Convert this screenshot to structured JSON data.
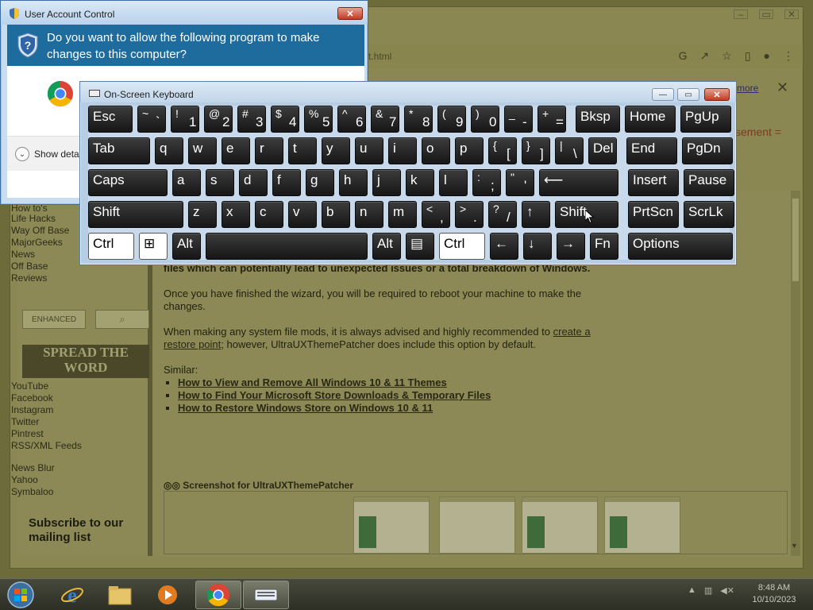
{
  "browser": {
    "address_partial": "t.html",
    "read_more": "more",
    "partial_right": "sement ="
  },
  "sidebar": {
    "links_top": [
      "How to's",
      "Life Hacks",
      "Way Off Base",
      "MajorGeeks",
      "News",
      "Off Base",
      "Reviews"
    ],
    "enhanced_label": "ENHANCED",
    "spread_line1": "SPREAD THE",
    "spread_line2": "WORD",
    "social_links": [
      "YouTube",
      "Facebook",
      "Instagram",
      "Twitter",
      "Pintrest",
      "RSS/XML Feeds"
    ],
    "reader_links": [
      "News Blur",
      "Yahoo",
      "Symbaloo"
    ],
    "subscribe": "Subscribe to our mailing list"
  },
  "article": {
    "p1": "files which can potentially lead to unexpected issues or a total breakdown of Windows.",
    "p2": "Once you have finished the wizard, you will be required to reboot your machine to make the changes.",
    "p3_before": "When making any system file mods, it is always advised and highly recommended to ",
    "p3_link": "create a restore point",
    "p3_after": "; however, UltraUXThemePatcher does include this option by default.",
    "similar_label": "Similar:",
    "similar": [
      "How to View and Remove All Windows 10 & 11 Themes",
      "How to Find Your Microsoft Store Downloads & Temporary Files",
      "How to Restore Windows Store on Windows 10 & 11"
    ],
    "screenshot_caption": "Screenshot for UltraUXThemePatcher"
  },
  "uac": {
    "title": "User Account Control",
    "close": "✕",
    "question": "Do you want to allow the following program to make changes to this computer?",
    "details": "Show detai"
  },
  "osk": {
    "title": "On-Screen Keyboard",
    "minimize": "—",
    "maximize": "▭",
    "close": "✕",
    "rows": [
      [
        {
          "label": "Esc"
        },
        {
          "top": "~",
          "bot": "`"
        },
        {
          "top": "!",
          "bot": "1"
        },
        {
          "top": "@",
          "bot": "2"
        },
        {
          "top": "#",
          "bot": "3"
        },
        {
          "top": "$",
          "bot": "4"
        },
        {
          "top": "%",
          "bot": "5"
        },
        {
          "top": "^",
          "bot": "6"
        },
        {
          "top": "&",
          "bot": "7"
        },
        {
          "top": "*",
          "bot": "8"
        },
        {
          "top": "(",
          "bot": "9"
        },
        {
          "top": ")",
          "bot": "0"
        },
        {
          "top": "_",
          "bot": "-"
        },
        {
          "top": "+",
          "bot": "="
        },
        {
          "label": "Bksp"
        },
        {
          "label": "Home"
        },
        {
          "label": "PgUp"
        }
      ],
      [
        {
          "label": "Tab"
        },
        {
          "label": "q"
        },
        {
          "label": "w"
        },
        {
          "label": "e"
        },
        {
          "label": "r"
        },
        {
          "label": "t"
        },
        {
          "label": "y"
        },
        {
          "label": "u"
        },
        {
          "label": "i"
        },
        {
          "label": "o"
        },
        {
          "label": "p"
        },
        {
          "top": "{",
          "bot": "["
        },
        {
          "top": "}",
          "bot": "]"
        },
        {
          "top": "|",
          "bot": "\\"
        },
        {
          "label": "Del"
        },
        {
          "label": "End"
        },
        {
          "label": "PgDn"
        }
      ],
      [
        {
          "label": "Caps"
        },
        {
          "label": "a"
        },
        {
          "label": "s"
        },
        {
          "label": "d"
        },
        {
          "label": "f"
        },
        {
          "label": "g"
        },
        {
          "label": "h"
        },
        {
          "label": "j"
        },
        {
          "label": "k"
        },
        {
          "label": "l"
        },
        {
          "top": ":",
          "bot": ";"
        },
        {
          "top": "\"",
          "bot": "'"
        },
        {
          "label": "⟵"
        },
        {
          "label": "Insert"
        },
        {
          "label": "Pause"
        }
      ],
      [
        {
          "label": "Shift"
        },
        {
          "label": "z"
        },
        {
          "label": "x"
        },
        {
          "label": "c"
        },
        {
          "label": "v"
        },
        {
          "label": "b"
        },
        {
          "label": "n"
        },
        {
          "label": "m"
        },
        {
          "top": "<",
          "bot": ","
        },
        {
          "top": ">",
          "bot": "."
        },
        {
          "top": "?",
          "bot": "/"
        },
        {
          "label": "↑"
        },
        {
          "label": "Shift"
        },
        {
          "label": "PrtScn"
        },
        {
          "label": "ScrLk"
        }
      ],
      [
        {
          "label": "Ctrl"
        },
        {
          "label": "⊞"
        },
        {
          "label": "Alt"
        },
        {
          "label": ""
        },
        {
          "label": "Alt"
        },
        {
          "label": "▤"
        },
        {
          "label": "Ctrl"
        },
        {
          "label": "←"
        },
        {
          "label": "↓"
        },
        {
          "label": "→"
        },
        {
          "label": "Fn"
        },
        {
          "label": "Options"
        }
      ]
    ]
  },
  "taskbar": {
    "items": [
      "start-orb",
      "internet-explorer",
      "file-explorer",
      "media-player",
      "chrome",
      "on-screen-keyboard"
    ],
    "time": "8:48 AM",
    "date": "10/10/2023"
  }
}
